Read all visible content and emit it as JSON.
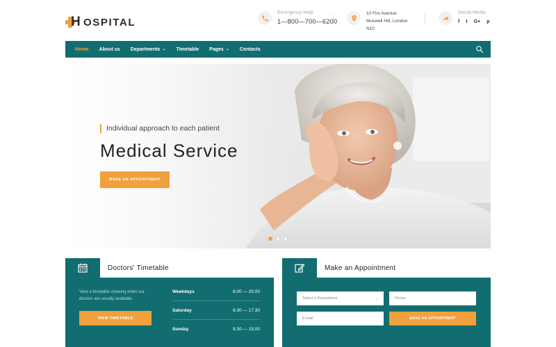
{
  "brand": {
    "logo_text": "OSPITAL",
    "accent": "#f0a03c",
    "primary": "#126d70"
  },
  "header": {
    "emergency": {
      "label": "Emergency Help",
      "value": "1—800—700—6200",
      "icon": "phone-icon"
    },
    "address": {
      "line1": "10 Firs Avenue,",
      "line2": "Muswell Hill, London",
      "line3": "N10",
      "icon": "location-pin-icon"
    },
    "social": {
      "label": "Social Media",
      "icon": "share-icon",
      "links": [
        "f",
        "t",
        "G+",
        "p"
      ]
    }
  },
  "nav": {
    "items": [
      {
        "label": "Home",
        "active": true
      },
      {
        "label": "About us"
      },
      {
        "label": "Departments",
        "dropdown": true
      },
      {
        "label": "Timetable"
      },
      {
        "label": "Pages",
        "dropdown": true
      },
      {
        "label": "Contacts"
      }
    ],
    "search_icon": "search-icon"
  },
  "hero": {
    "eyebrow": "Individual approach to each patient",
    "title": "Medical Service",
    "button": "MAKE AN APPOINTMENT",
    "slides": 3,
    "active_slide": 1
  },
  "timetable": {
    "title": "Doctors' Timetable",
    "icon": "calendar-icon",
    "text": "View a timetable showing when our doctors are usually available.",
    "button": "VIEW TIMETABLE",
    "rows": [
      {
        "day": "Weekdays",
        "hours": "8.00 — 20.00"
      },
      {
        "day": "Saturday",
        "hours": "9.30 — 17.30"
      },
      {
        "day": "Sunday",
        "hours": "9.30 — 15.00"
      }
    ]
  },
  "appointment": {
    "title": "Make an Appointment",
    "icon": "edit-icon",
    "department_placeholder": "Select a Department",
    "phone_placeholder": "Phone",
    "email_placeholder": "E-mail",
    "button": "MAKE AN APPOINTMENT"
  }
}
